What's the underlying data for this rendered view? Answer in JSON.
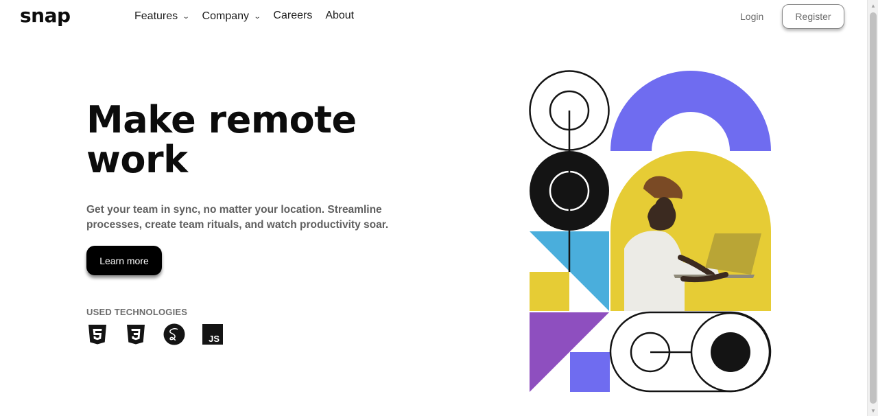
{
  "header": {
    "logo": "snap",
    "nav": [
      {
        "label": "Features",
        "dropdown": true
      },
      {
        "label": "Company",
        "dropdown": true
      },
      {
        "label": "Careers",
        "dropdown": false
      },
      {
        "label": "About",
        "dropdown": false
      }
    ],
    "login_label": "Login",
    "register_label": "Register"
  },
  "hero": {
    "title_line1": "Make remote",
    "title_line2": "work",
    "description": "Get your team in sync, no matter your location. Streamline processes, create team rituals, and watch productivity soar.",
    "cta_label": "Learn more"
  },
  "technologies": {
    "label": "USED TECHNOLOGIES",
    "items": [
      {
        "icon": "html5-icon"
      },
      {
        "icon": "css3-icon"
      },
      {
        "icon": "sass-icon"
      },
      {
        "icon": "javascript-icon",
        "text": "JS"
      }
    ]
  },
  "colors": {
    "purple": "#6f6cf0",
    "yellow": "#e6cc35",
    "blue": "#4aaedc",
    "violet": "#8e4fbf",
    "black": "#111111"
  }
}
